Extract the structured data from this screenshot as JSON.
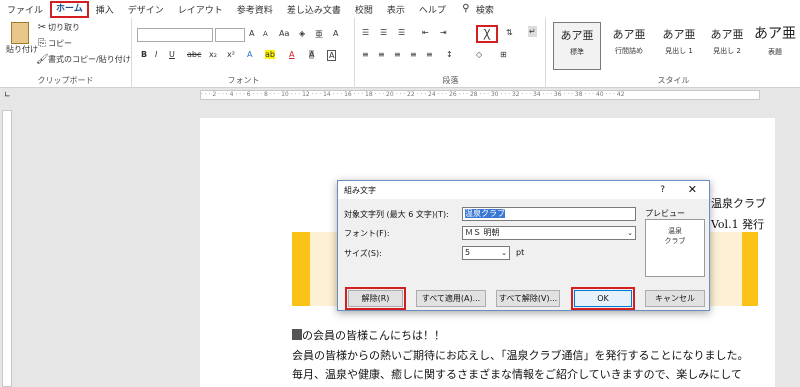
{
  "menu": {
    "items": [
      "ファイル",
      "ホーム",
      "挿入",
      "デザイン",
      "レイアウト",
      "参考資料",
      "差し込み文書",
      "校閲",
      "表示",
      "ヘルプ"
    ],
    "search_label": "検索"
  },
  "ribbon": {
    "clipboard": {
      "paste": "貼り付け",
      "cut": "切り取り",
      "copy": "コピー",
      "format_painter": "書式のコピー/貼り付け",
      "label": "クリップボード"
    },
    "font": {
      "label": "フォント",
      "bold": "B",
      "italic": "I",
      "underline": "U",
      "strike": "abc",
      "subscript": "x₂",
      "superscript": "x²",
      "grow": "A",
      "shrink": "A",
      "case": "Aa",
      "text_effect": "A",
      "highlight": "ab",
      "font_color": "A",
      "shading": "A",
      "border": "A"
    },
    "paragraph": {
      "label": "段落",
      "phonetic_icon": "亜"
    },
    "styles": {
      "label": "スタイル",
      "cards": [
        {
          "sample": "あア亜",
          "name": "標準"
        },
        {
          "sample": "あア亜",
          "name": "行間詰め"
        },
        {
          "sample": "あア亜",
          "name": "見出し 1"
        },
        {
          "sample": "あア亜",
          "name": "見出し 2"
        },
        {
          "sample": "あア亜",
          "name": "表題"
        }
      ]
    }
  },
  "document": {
    "right_line1": "温泉クラブ",
    "right_line2": "Vol.1 発行",
    "greeting": "の会員の皆様こんにちは！！",
    "para1": "会員の皆様からの熱いご期待にお応えし、「温泉クラブ通信」を発行することになりました。",
    "para2": "毎月、温泉や健康、癒しに関するさまざまな情報をご紹介していきますので、楽しみにして"
  },
  "dialog": {
    "title": "組み文字",
    "help": "?",
    "close": "✕",
    "target_label": "対象文字列 (最大 6 文字)(T):",
    "target_value": "温泉クラブ",
    "font_label": "フォント(F):",
    "font_value": "ＭＳ 明朝",
    "size_label": "サイズ(S):",
    "size_value": "5",
    "size_unit": "pt",
    "preview_label": "プレビュー",
    "preview_line1": "温泉",
    "preview_line2": "クラブ",
    "buttons": {
      "unset": "解除(R)",
      "apply_all": "すべて適用(A)...",
      "unset_all": "すべて解除(V)...",
      "ok": "OK",
      "cancel": "キャンセル"
    }
  },
  "colors": {
    "accent_red": "#d21f1f",
    "banner_yellow": "#fbc217",
    "ribbon_blue": "#1e4e8c"
  }
}
